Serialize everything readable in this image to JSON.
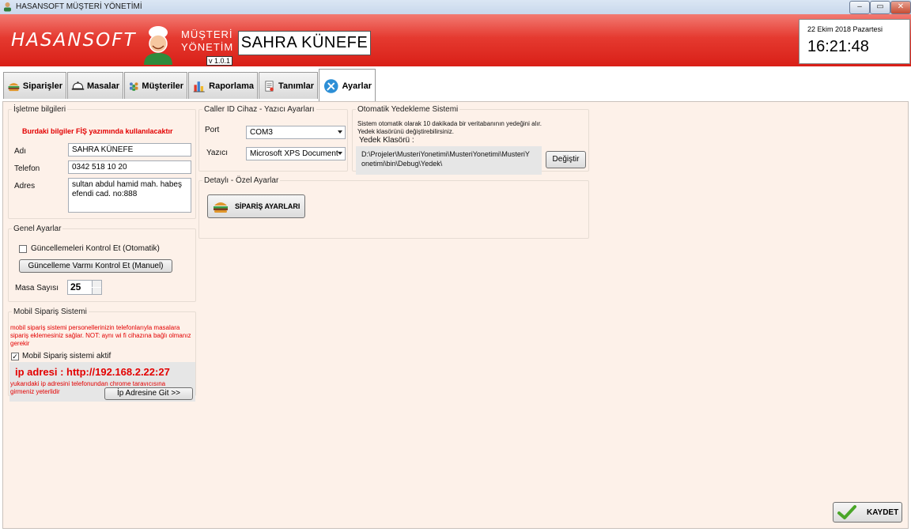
{
  "window": {
    "title": "HASANSOFT MÜŞTERİ YÖNETİMİ",
    "minimize": "–",
    "maximize": "▭",
    "close": "✕"
  },
  "header": {
    "logo": "HASANSOFT",
    "product_line1": "MÜŞTERİ",
    "product_line2": "YÖNETİM",
    "version": "v 1.0.1",
    "business_name": "SAHRA KÜNEFE",
    "date": "22 Ekim 2018 Pazartesi",
    "time": "16:21:48"
  },
  "tabs": [
    {
      "label": "Siparişler",
      "icon": "burger-icon"
    },
    {
      "label": "Masalar",
      "icon": "cloche-icon"
    },
    {
      "label": "Müşteriler",
      "icon": "people-icon"
    },
    {
      "label": "Raporlama",
      "icon": "bar-chart-icon"
    },
    {
      "label": "Tanımlar",
      "icon": "document-icon"
    },
    {
      "label": "Ayarlar",
      "icon": "tools-icon",
      "active": true
    }
  ],
  "business_info": {
    "legend": "İşletme bilgileri",
    "note": "Burdaki bilgiler FİŞ yazımında kullanılacaktır",
    "name_label": "Adı",
    "name_value": "SAHRA KÜNEFE",
    "phone_label": "Telefon",
    "phone_value": "0342 518 10 20",
    "address_label": "Adres",
    "address_value": "sultan abdul hamid mah. habeş efendi cad. no:888"
  },
  "general": {
    "legend": "Genel Ayarlar",
    "auto_update_label": "Güncellemeleri Kontrol Et (Otomatik)",
    "manual_update_button": "Güncelleme Varmı Kontrol Et (Manuel)",
    "table_count_label": "Masa Sayısı",
    "table_count_value": "25"
  },
  "mobile": {
    "legend": "Mobil Sipariş Sistemi",
    "note": "mobil sipariş sistemi personellerinizin telefonlarıyla masalara sipariş eklemesiniz sağlar. NOT: aynı wi fi cihazına bağlı olmanız gerekir",
    "active_label": "Mobil Sipariş sistemi aktif",
    "active_checked": "✓",
    "ip_text": "ip adresi : http://192.168.2.22:27",
    "ip_hint": "yukarıdaki ip adresini telefonundan chrome taravıcısına girmeniz yeterlidir",
    "go_button": "İp Adresine Git >>"
  },
  "caller": {
    "legend": "Caller ID Cihaz - Yazıcı Ayarları",
    "port_label": "Port",
    "port_value": "COM3",
    "printer_label": "Yazıcı",
    "printer_value": "Microsoft XPS Document"
  },
  "backup": {
    "legend": "Otomatik Yedekleme Sistemi",
    "desc1": "Sistem otomatik olarak 10 dakikada bir veritabanının yedeğini alır.",
    "desc2": "Yedek klasörünü değiştirebilirsiniz.",
    "folder_label": "Yedek Klasörü :",
    "folder_path": "D:\\Projeler\\MusteriYonetimi\\MusteriYonetimi\\MusteriYonetimi\\bin\\Debug\\Yedek\\",
    "change_button": "Değiştir"
  },
  "detail": {
    "legend": "Detaylı - Özel Ayarlar",
    "order_settings_button": "SİPARİŞ AYARLARI"
  },
  "save_button": "KAYDET",
  "colors": {
    "header_red": "#e53a30",
    "content_bg": "#fdf1e9",
    "note_red": "#e30000"
  }
}
